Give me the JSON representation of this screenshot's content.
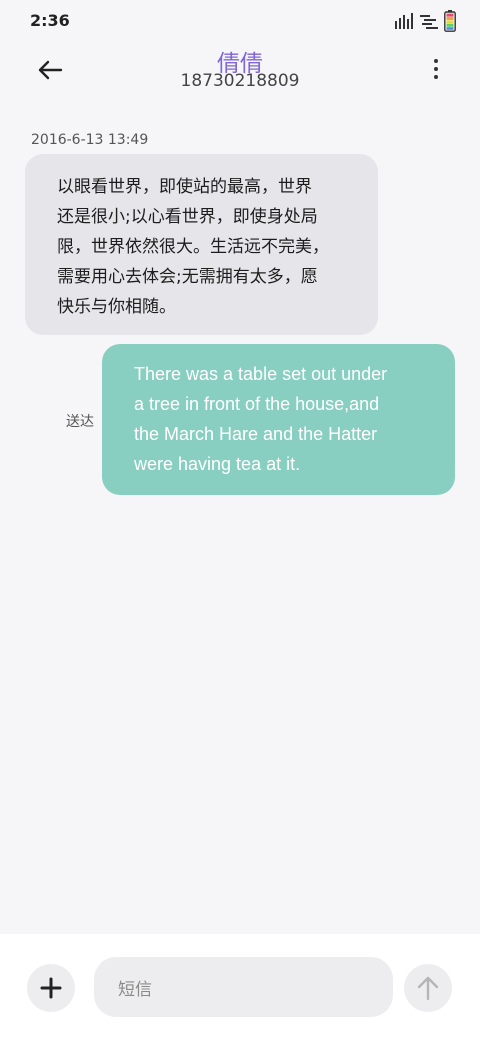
{
  "status_bar": {
    "time": "2:36",
    "icons": [
      "signal-icon",
      "wifi-icon",
      "battery-icon"
    ]
  },
  "header": {
    "contact_name": "倩倩",
    "contact_number": "18730218809",
    "accent_color": "#8066d9"
  },
  "conversation": {
    "timestamp": "2016-6-13 13:49",
    "incoming": {
      "lines": [
        "以眼看世界，即使站的最高，世界",
        "还是很小;以心看世界，即使身处局",
        "限，世界依然很大。生活远不完美，",
        "需要用心去体会;无需拥有太多，愿",
        "快乐与你相随。"
      ],
      "bubble_color": "#e6e6ea"
    },
    "outgoing": {
      "status": "送达",
      "lines": [
        "There was a table set out under",
        "a tree in front of the house,and",
        "the March Hare and the Hatter",
        "were having tea at it."
      ],
      "bubble_color": "#89cfc1"
    }
  },
  "composer": {
    "placeholder": "短信",
    "icons": [
      "plus-icon",
      "send-arrow-icon"
    ]
  }
}
